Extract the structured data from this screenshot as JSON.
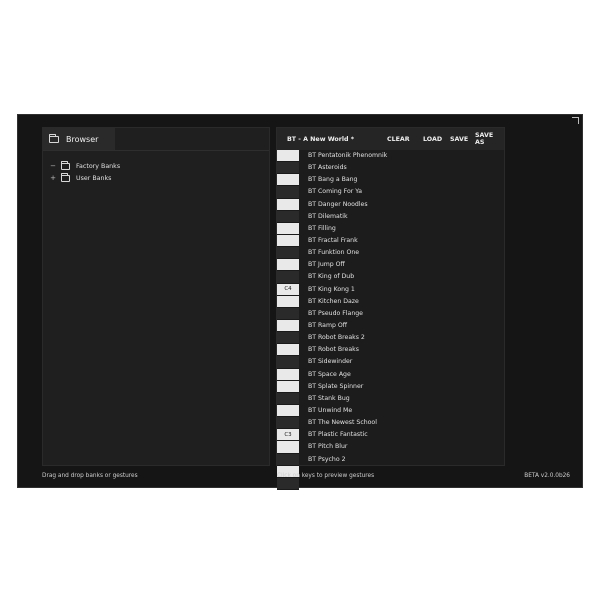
{
  "browser": {
    "title": "Browser",
    "tree": [
      {
        "expander": "−",
        "label": "Factory Banks"
      },
      {
        "expander": "+",
        "label": "User Banks"
      }
    ]
  },
  "gestures": {
    "bank_title": "BT - A New World *",
    "buttons": {
      "clear": "CLEAR",
      "load": "LOAD",
      "save": "SAVE",
      "save_as": "SAVE AS"
    },
    "keys": [
      {
        "color": "white",
        "label": ""
      },
      {
        "color": "black",
        "label": ""
      },
      {
        "color": "white",
        "label": ""
      },
      {
        "color": "black",
        "label": ""
      },
      {
        "color": "white",
        "label": ""
      },
      {
        "color": "black",
        "label": ""
      },
      {
        "color": "white",
        "label": ""
      },
      {
        "color": "white",
        "label": ""
      },
      {
        "color": "black",
        "label": ""
      },
      {
        "color": "white",
        "label": ""
      },
      {
        "color": "black",
        "label": ""
      },
      {
        "color": "white",
        "label": "C4"
      },
      {
        "color": "white",
        "label": ""
      },
      {
        "color": "black",
        "label": ""
      },
      {
        "color": "white",
        "label": ""
      },
      {
        "color": "black",
        "label": ""
      },
      {
        "color": "white",
        "label": ""
      },
      {
        "color": "black",
        "label": ""
      },
      {
        "color": "white",
        "label": ""
      },
      {
        "color": "white",
        "label": ""
      },
      {
        "color": "black",
        "label": ""
      },
      {
        "color": "white",
        "label": ""
      },
      {
        "color": "black",
        "label": ""
      },
      {
        "color": "white",
        "label": "C3"
      },
      {
        "color": "white",
        "label": ""
      },
      {
        "color": "black",
        "label": ""
      },
      {
        "color": "white",
        "label": ""
      },
      {
        "color": "black",
        "label": ""
      }
    ],
    "items": [
      "BT Pentatonik Phenomnik",
      "BT Asteroids",
      "BT Bang a Bang",
      "BT Coming For Ya",
      "BT Danger Noodles",
      "BT Dilematik",
      "BT Filling",
      "BT Fractal Frank",
      "BT Funktion One",
      "BT Jump Off",
      "BT King of Dub",
      "BT King Kong 1",
      "BT Kitchen Daze",
      "BT Pseudo Flange",
      "BT Ramp Off",
      "BT Robot Breaks 2",
      "BT Robot Breaks",
      "BT Sidewinder",
      "BT Space Age",
      "BT Splate Spinner",
      "BT Stank Bug",
      "BT Unwind Me",
      "BT The Newest School",
      "BT Plastic Fantastic",
      "BT Pitch Blur",
      "BT Psycho 2"
    ]
  },
  "status": {
    "left": "Drag and drop banks or gestures",
    "middle": "Click on keys to preview gestures",
    "right": "BETA v2.0.0b26"
  },
  "colors": {
    "background": "#151515",
    "panel": "#1f1f1f",
    "text": "#e6e6e6"
  }
}
